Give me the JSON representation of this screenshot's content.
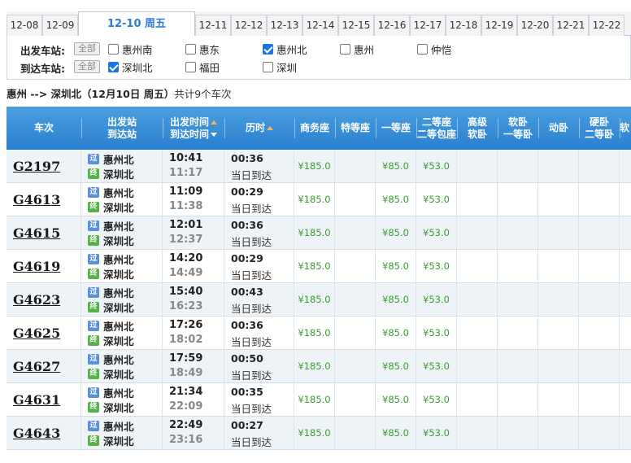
{
  "dates": [
    {
      "label": "12-08",
      "active": false
    },
    {
      "label": "12-09",
      "active": false
    },
    {
      "label": "12-10 周五",
      "active": true
    },
    {
      "label": "12-11",
      "active": false
    },
    {
      "label": "12-12",
      "active": false
    },
    {
      "label": "12-13",
      "active": false
    },
    {
      "label": "12-14",
      "active": false
    },
    {
      "label": "12-15",
      "active": false
    },
    {
      "label": "12-16",
      "active": false
    },
    {
      "label": "12-17",
      "active": false
    },
    {
      "label": "12-18",
      "active": false
    },
    {
      "label": "12-19",
      "active": false
    },
    {
      "label": "12-20",
      "active": false
    },
    {
      "label": "12-21",
      "active": false
    },
    {
      "label": "12-22",
      "active": false
    }
  ],
  "filter": {
    "depart_label": "出发车站:",
    "arrive_label": "到达车站:",
    "all_label": "全部",
    "depart_options": [
      {
        "label": "惠州南",
        "checked": false
      },
      {
        "label": "惠东",
        "checked": false
      },
      {
        "label": "惠州北",
        "checked": true
      },
      {
        "label": "惠州",
        "checked": false
      },
      {
        "label": "仲恺",
        "checked": false
      }
    ],
    "arrive_options": [
      {
        "label": "深圳北",
        "checked": true
      },
      {
        "label": "福田",
        "checked": false
      },
      {
        "label": "深圳",
        "checked": false
      }
    ]
  },
  "route": {
    "text": "惠州 --> 深圳北（12月10日  周五）",
    "count": "共计9个车次"
  },
  "headers": {
    "train": "车次",
    "depart_station": "出发站",
    "arrive_station": "到达站",
    "depart_time": "出发时间",
    "arrive_time": "到达时间",
    "duration": "历时",
    "business": "商务座",
    "special": "特等座",
    "first": "一等座",
    "second_a": "二等座",
    "second_b": "二等包座",
    "deluxe_a": "高级",
    "deluxe_b": "软卧",
    "soft_a": "软卧",
    "soft_b": "一等卧",
    "moving": "动卧",
    "hard_a": "硬卧",
    "hard_b": "二等卧",
    "last": "软"
  },
  "badges": {
    "pass": "过",
    "end": "终"
  },
  "trains": [
    {
      "no": "G2197",
      "from": "惠州北",
      "to": "深圳北",
      "dep": "10:41",
      "arr": "11:17",
      "dur": "00:36",
      "note": "当日到达",
      "business": "¥185.0",
      "first": "¥85.0",
      "second": "¥53.0"
    },
    {
      "no": "G4613",
      "from": "惠州北",
      "to": "深圳北",
      "dep": "11:09",
      "arr": "11:38",
      "dur": "00:29",
      "note": "当日到达",
      "business": "¥185.0",
      "first": "¥85.0",
      "second": "¥53.0"
    },
    {
      "no": "G4615",
      "from": "惠州北",
      "to": "深圳北",
      "dep": "12:01",
      "arr": "12:37",
      "dur": "00:36",
      "note": "当日到达",
      "business": "¥185.0",
      "first": "¥85.0",
      "second": "¥53.0"
    },
    {
      "no": "G4619",
      "from": "惠州北",
      "to": "深圳北",
      "dep": "14:20",
      "arr": "14:49",
      "dur": "00:29",
      "note": "当日到达",
      "business": "¥185.0",
      "first": "¥85.0",
      "second": "¥53.0"
    },
    {
      "no": "G4623",
      "from": "惠州北",
      "to": "深圳北",
      "dep": "15:40",
      "arr": "16:23",
      "dur": "00:43",
      "note": "当日到达",
      "business": "¥185.0",
      "first": "¥85.0",
      "second": "¥53.0"
    },
    {
      "no": "G4625",
      "from": "惠州北",
      "to": "深圳北",
      "dep": "17:26",
      "arr": "18:02",
      "dur": "00:36",
      "note": "当日到达",
      "business": "¥185.0",
      "first": "¥85.0",
      "second": "¥53.0"
    },
    {
      "no": "G4627",
      "from": "惠州北",
      "to": "深圳北",
      "dep": "17:59",
      "arr": "18:49",
      "dur": "00:50",
      "note": "当日到达",
      "business": "¥185.0",
      "first": "¥85.0",
      "second": "¥53.0"
    },
    {
      "no": "G4631",
      "from": "惠州北",
      "to": "深圳北",
      "dep": "21:34",
      "arr": "22:09",
      "dur": "00:35",
      "note": "当日到达",
      "business": "¥185.0",
      "first": "¥85.0",
      "second": "¥53.0"
    },
    {
      "no": "G4643",
      "from": "惠州北",
      "to": "深圳北",
      "dep": "22:49",
      "arr": "23:16",
      "dur": "00:27",
      "note": "当日到达",
      "business": "¥185.0",
      "first": "¥85.0",
      "second": "¥53.0"
    }
  ]
}
